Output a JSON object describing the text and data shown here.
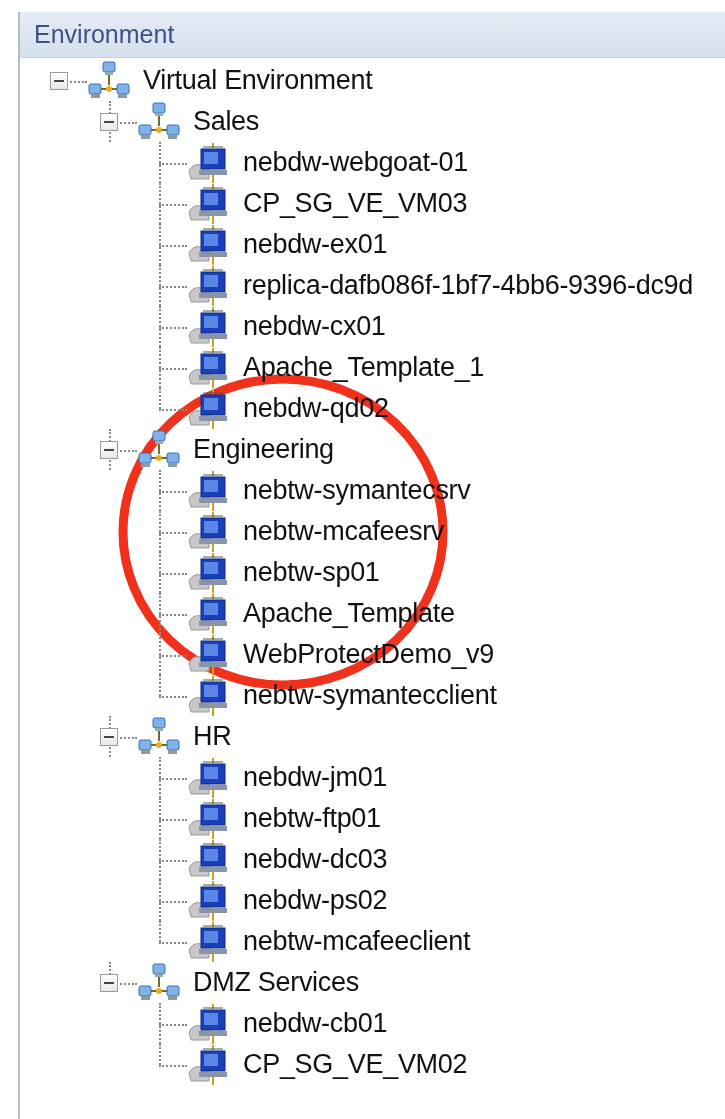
{
  "panel": {
    "title": "Environment"
  },
  "tree": [
    {
      "label": "Virtual Environment",
      "kind": "group",
      "expanded": true,
      "children": [
        {
          "label": "Sales",
          "kind": "group",
          "expanded": true,
          "children": [
            {
              "label": "nebdw-webgoat-01",
              "kind": "vm"
            },
            {
              "label": "CP_SG_VE_VM03",
              "kind": "vm"
            },
            {
              "label": "nebdw-ex01",
              "kind": "vm"
            },
            {
              "label": "replica-dafb086f-1bf7-4bb6-9396-dc9d",
              "kind": "vm"
            },
            {
              "label": "nebdw-cx01",
              "kind": "vm"
            },
            {
              "label": "Apache_Template_1",
              "kind": "vm"
            },
            {
              "label": "nebdw-qd02",
              "kind": "vm"
            }
          ]
        },
        {
          "label": "Engineering",
          "kind": "group",
          "expanded": true,
          "children": [
            {
              "label": "nebtw-symantecsrv",
              "kind": "vm"
            },
            {
              "label": "nebtw-mcafeesrv",
              "kind": "vm"
            },
            {
              "label": "nebtw-sp01",
              "kind": "vm"
            },
            {
              "label": "Apache_Template",
              "kind": "vm"
            },
            {
              "label": "WebProtectDemo_v9",
              "kind": "vm"
            },
            {
              "label": "nebtw-symantecclient",
              "kind": "vm"
            }
          ]
        },
        {
          "label": "HR",
          "kind": "group",
          "expanded": true,
          "children": [
            {
              "label": "nebdw-jm01",
              "kind": "vm"
            },
            {
              "label": "nebtw-ftp01",
              "kind": "vm"
            },
            {
              "label": "nebdw-dc03",
              "kind": "vm"
            },
            {
              "label": "nebdw-ps02",
              "kind": "vm"
            },
            {
              "label": "nebtw-mcafeeclient",
              "kind": "vm"
            }
          ]
        },
        {
          "label": "DMZ Services",
          "kind": "group",
          "expanded": true,
          "children": [
            {
              "label": "nebdw-cb01",
              "kind": "vm"
            },
            {
              "label": "CP_SG_VE_VM02",
              "kind": "vm"
            }
          ]
        }
      ]
    }
  ],
  "annotations": [
    {
      "kind": "circle"
    }
  ]
}
